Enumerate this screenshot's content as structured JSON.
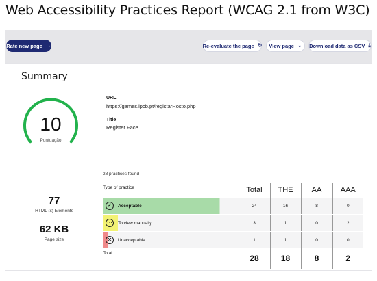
{
  "header": {
    "title": "Web Accessibility Practices Report (WCAG 2.1 from W3C)"
  },
  "toolbar": {
    "rate_label": "Rate new page",
    "reevaluate_label": "Re-evaluate the page",
    "view_label": "View page",
    "download_label": "Download data as CSV"
  },
  "summary": {
    "heading": "Summary",
    "score": "10",
    "score_fraction": 0.1,
    "score_label": "Pontuação",
    "url_label": "URL",
    "url_value": "https://games.ipcb.pt/registarRosto.php",
    "title_label": "Title",
    "title_value": "Register Face",
    "elements_count": "77",
    "elements_label": "HTML (x) Elements",
    "page_size": "62 KB",
    "page_size_label": "Page size"
  },
  "practices": {
    "found_text": "28 practices found",
    "type_header": "Type of practice",
    "columns": [
      "Total",
      "THE",
      "AA",
      "AAA"
    ],
    "rows": [
      {
        "label": "Acceptable",
        "icon": "check-icon",
        "values": [
          "24",
          "16",
          "8",
          "0"
        ],
        "color": "#a8dba8",
        "bar": 0.86
      },
      {
        "label": "To view manually",
        "icon": "ellipsis-icon",
        "values": [
          "3",
          "1",
          "0",
          "2"
        ],
        "color": "#f2f274",
        "bar": 0.11
      },
      {
        "label": "Unacceptable",
        "icon": "close-icon",
        "values": [
          "1",
          "1",
          "0",
          "0"
        ],
        "color": "#f08a8a",
        "bar": 0.04
      }
    ],
    "total_label": "Total",
    "totals": [
      "28",
      "18",
      "8",
      "2"
    ]
  },
  "colors": {
    "primary": "#1f2a72",
    "gauge": "#22b24c",
    "band": "#e6e6e9"
  }
}
